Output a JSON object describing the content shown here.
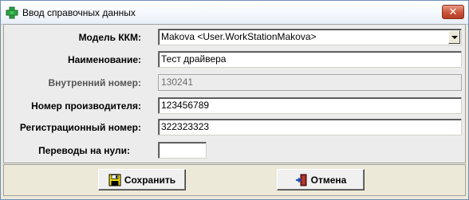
{
  "window": {
    "title": "Ввод справочных данных",
    "close_icon": "close-icon",
    "app_icon": "green-plus-icon"
  },
  "form": {
    "kkm_model": {
      "label": "Модель ККМ:",
      "value": "Makova  <User.WorkStationMakova>"
    },
    "name": {
      "label": "Наименование:",
      "value": "Тест драйвера"
    },
    "internal_number": {
      "label": "Внутренний номер:",
      "value": "130241"
    },
    "manufacturer_number": {
      "label": "Номер производителя:",
      "value": "123456789"
    },
    "registration_number": {
      "label": "Регистрационный номер:",
      "value": "322323323"
    },
    "zero_transfers": {
      "label": "Переводы на нули:",
      "value": ""
    }
  },
  "buttons": {
    "save_label": "Сохранить",
    "save_icon": "floppy-disk-icon",
    "cancel_label": "Отмена",
    "cancel_icon": "exit-door-icon"
  },
  "colors": {
    "window_bg": "#ece9d8",
    "form_bg": "#ececec",
    "close_button": "#c9533b",
    "disabled_text": "#6d6d6d"
  }
}
